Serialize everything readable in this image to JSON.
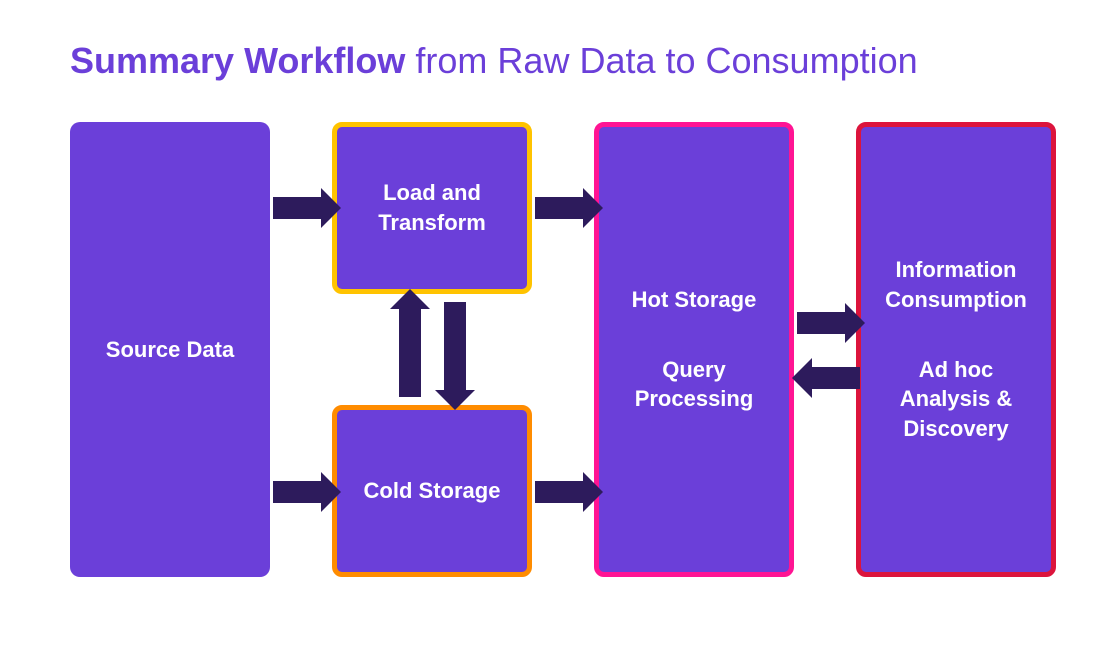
{
  "title": {
    "bold": "Summary Workflow",
    "rest": " from Raw Data to Consumption"
  },
  "boxes": {
    "source": "Source Data",
    "load": "Load and Transform",
    "cold": "Cold Storage",
    "hot1": "Hot Storage",
    "hot2": "Query Processing",
    "info1": "Information Consumption",
    "info2": "Ad hoc Analysis & Discovery"
  }
}
